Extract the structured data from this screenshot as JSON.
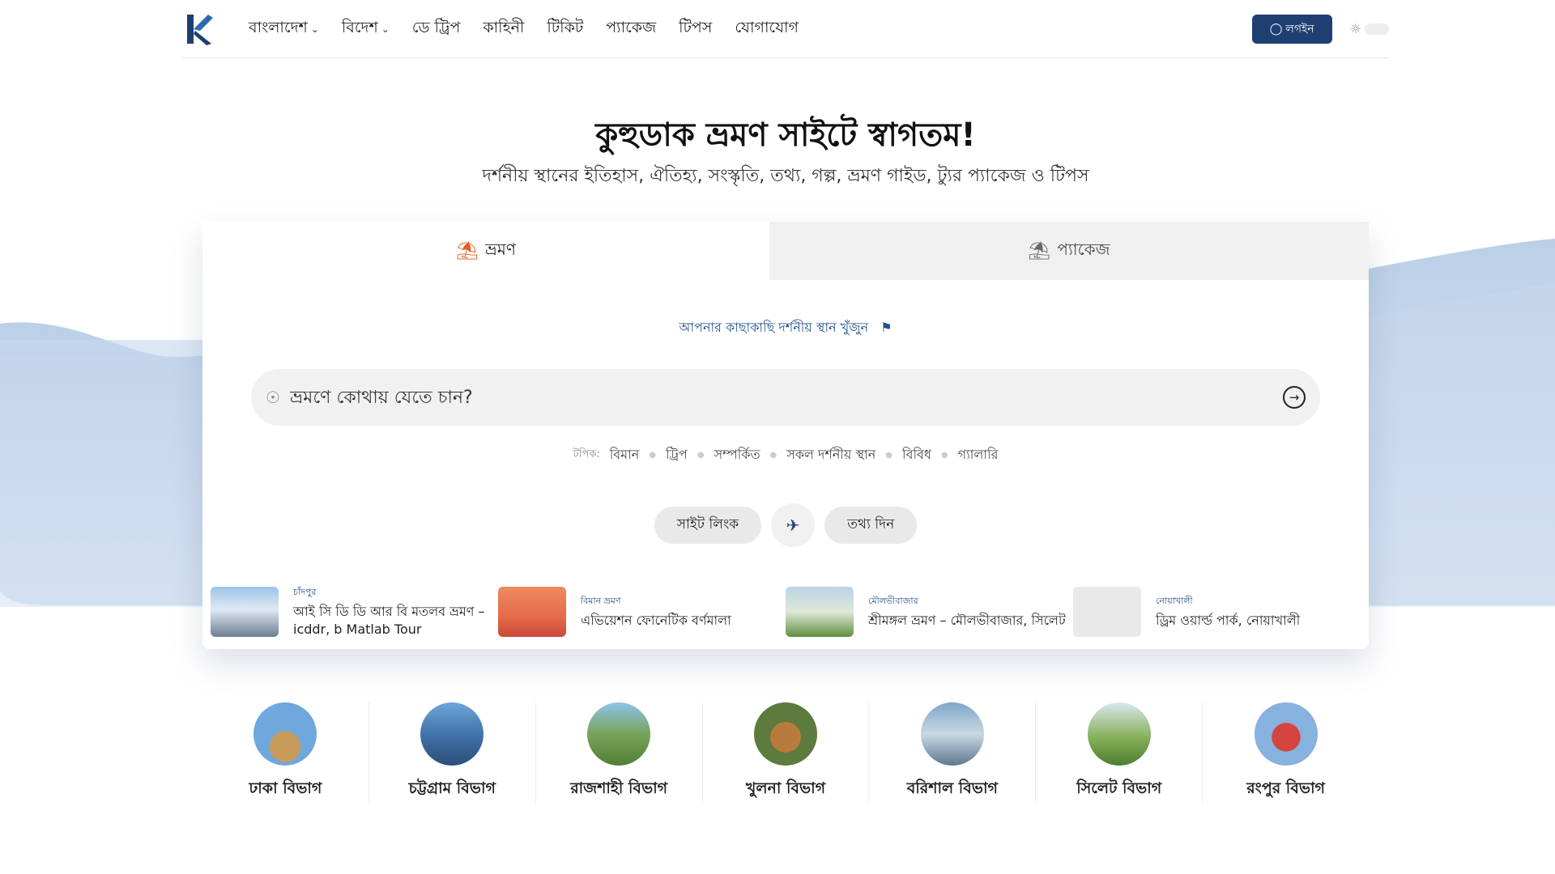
{
  "header": {
    "logo_icon": "kuhudak-logo-icon",
    "nav": [
      {
        "label": "বাংলাদেশ",
        "dropdown": true
      },
      {
        "label": "বিদেশ",
        "dropdown": true
      },
      {
        "label": "ডে ট্রিপ",
        "dropdown": false
      },
      {
        "label": "কাহিনী",
        "dropdown": false
      },
      {
        "label": "টিকিট",
        "dropdown": false
      },
      {
        "label": "প্যাকেজ",
        "dropdown": false
      },
      {
        "label": "টিপস",
        "dropdown": false
      },
      {
        "label": "যোগাযোগ",
        "dropdown": false
      }
    ],
    "login_label": "লগইন",
    "accent": "#1f3f73"
  },
  "hero": {
    "title": "কুহুডাক ভ্রমণ সাইটে স্বাগতম!",
    "subtitle": "দর্শনীয় স্থানের ইতিহাস, ঐতিহ্য, সংস্কৃতি, তথ্য, গল্প, ভ্রমণ গাইড, ট্যুর প্যাকেজ ও টিপস"
  },
  "tabs": [
    {
      "label": "ভ্রমণ",
      "icon": "hiker-icon",
      "active": true
    },
    {
      "label": "প্যাকেজ",
      "icon": "beach-umbrella-icon",
      "active": false
    }
  ],
  "nearby_link": "আপনার কাছাকাছি দর্শনীয় স্থান খুঁজুন",
  "search": {
    "placeholder": "ভ্রমণে কোথায় যেতে চান?",
    "value": ""
  },
  "topics": {
    "label": "টপিক:",
    "items": [
      "বিমান",
      "ট্রিপ",
      "সম্পর্কিত",
      "সকল দর্শনীয় স্থান",
      "বিবিধ",
      "গ্যালারি"
    ]
  },
  "actions": {
    "site_link": "সাইট লিংক",
    "give_info": "তথ্য দিন"
  },
  "recent": [
    {
      "category": "চাঁদপুর",
      "title": "আই সি ডি ডি আর বি মতলব ভ্রমণ – icddr, b Matlab Tour"
    },
    {
      "category": "বিমান ভ্রমণ",
      "title": "এভিয়েশন ফোনেটিক বর্ণমালা"
    },
    {
      "category": "মৌলভীবাজার",
      "title": "শ্রীমঙ্গল ভ্রমণ – মৌলভীবাজার, সিলেট"
    },
    {
      "category": "নোয়াখালী",
      "title": "ড্রিম ওয়ার্ল্ড পার্ক, নোয়াখালী"
    }
  ],
  "divisions": [
    {
      "name": "ঢাকা বিভাগ"
    },
    {
      "name": "চট্টগ্রাম বিভাগ"
    },
    {
      "name": "রাজশাহী বিভাগ"
    },
    {
      "name": "খুলনা বিভাগ"
    },
    {
      "name": "বরিশাল বিভাগ"
    },
    {
      "name": "সিলেট বিভাগ"
    },
    {
      "name": "রংপুর বিভাগ"
    }
  ]
}
